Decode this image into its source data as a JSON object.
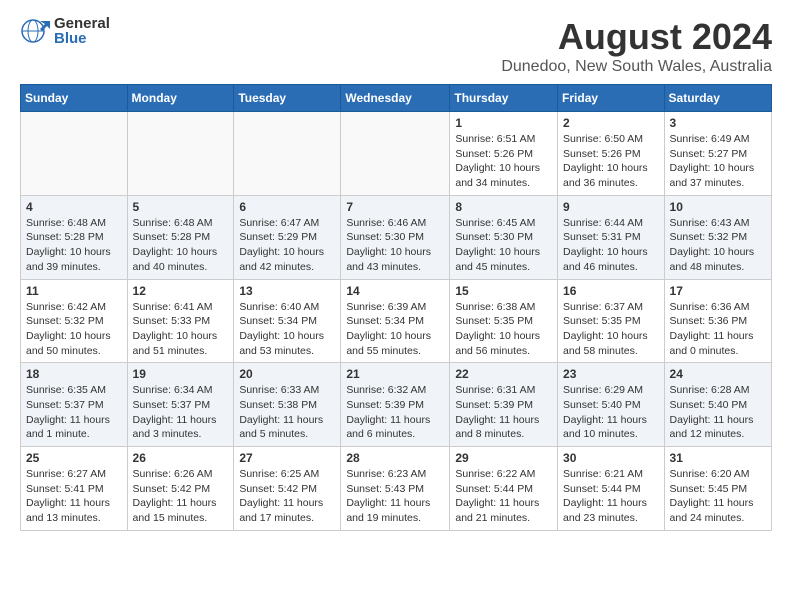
{
  "logo": {
    "general": "General",
    "blue": "Blue"
  },
  "header": {
    "title": "August 2024",
    "subtitle": "Dunedoo, New South Wales, Australia"
  },
  "weekdays": [
    "Sunday",
    "Monday",
    "Tuesday",
    "Wednesday",
    "Thursday",
    "Friday",
    "Saturday"
  ],
  "weeks": [
    [
      {
        "day": "",
        "info": ""
      },
      {
        "day": "",
        "info": ""
      },
      {
        "day": "",
        "info": ""
      },
      {
        "day": "",
        "info": ""
      },
      {
        "day": "1",
        "info": "Sunrise: 6:51 AM\nSunset: 5:26 PM\nDaylight: 10 hours and 34 minutes."
      },
      {
        "day": "2",
        "info": "Sunrise: 6:50 AM\nSunset: 5:26 PM\nDaylight: 10 hours and 36 minutes."
      },
      {
        "day": "3",
        "info": "Sunrise: 6:49 AM\nSunset: 5:27 PM\nDaylight: 10 hours and 37 minutes."
      }
    ],
    [
      {
        "day": "4",
        "info": "Sunrise: 6:48 AM\nSunset: 5:28 PM\nDaylight: 10 hours and 39 minutes."
      },
      {
        "day": "5",
        "info": "Sunrise: 6:48 AM\nSunset: 5:28 PM\nDaylight: 10 hours and 40 minutes."
      },
      {
        "day": "6",
        "info": "Sunrise: 6:47 AM\nSunset: 5:29 PM\nDaylight: 10 hours and 42 minutes."
      },
      {
        "day": "7",
        "info": "Sunrise: 6:46 AM\nSunset: 5:30 PM\nDaylight: 10 hours and 43 minutes."
      },
      {
        "day": "8",
        "info": "Sunrise: 6:45 AM\nSunset: 5:30 PM\nDaylight: 10 hours and 45 minutes."
      },
      {
        "day": "9",
        "info": "Sunrise: 6:44 AM\nSunset: 5:31 PM\nDaylight: 10 hours and 46 minutes."
      },
      {
        "day": "10",
        "info": "Sunrise: 6:43 AM\nSunset: 5:32 PM\nDaylight: 10 hours and 48 minutes."
      }
    ],
    [
      {
        "day": "11",
        "info": "Sunrise: 6:42 AM\nSunset: 5:32 PM\nDaylight: 10 hours and 50 minutes."
      },
      {
        "day": "12",
        "info": "Sunrise: 6:41 AM\nSunset: 5:33 PM\nDaylight: 10 hours and 51 minutes."
      },
      {
        "day": "13",
        "info": "Sunrise: 6:40 AM\nSunset: 5:34 PM\nDaylight: 10 hours and 53 minutes."
      },
      {
        "day": "14",
        "info": "Sunrise: 6:39 AM\nSunset: 5:34 PM\nDaylight: 10 hours and 55 minutes."
      },
      {
        "day": "15",
        "info": "Sunrise: 6:38 AM\nSunset: 5:35 PM\nDaylight: 10 hours and 56 minutes."
      },
      {
        "day": "16",
        "info": "Sunrise: 6:37 AM\nSunset: 5:35 PM\nDaylight: 10 hours and 58 minutes."
      },
      {
        "day": "17",
        "info": "Sunrise: 6:36 AM\nSunset: 5:36 PM\nDaylight: 11 hours and 0 minutes."
      }
    ],
    [
      {
        "day": "18",
        "info": "Sunrise: 6:35 AM\nSunset: 5:37 PM\nDaylight: 11 hours and 1 minute."
      },
      {
        "day": "19",
        "info": "Sunrise: 6:34 AM\nSunset: 5:37 PM\nDaylight: 11 hours and 3 minutes."
      },
      {
        "day": "20",
        "info": "Sunrise: 6:33 AM\nSunset: 5:38 PM\nDaylight: 11 hours and 5 minutes."
      },
      {
        "day": "21",
        "info": "Sunrise: 6:32 AM\nSunset: 5:39 PM\nDaylight: 11 hours and 6 minutes."
      },
      {
        "day": "22",
        "info": "Sunrise: 6:31 AM\nSunset: 5:39 PM\nDaylight: 11 hours and 8 minutes."
      },
      {
        "day": "23",
        "info": "Sunrise: 6:29 AM\nSunset: 5:40 PM\nDaylight: 11 hours and 10 minutes."
      },
      {
        "day": "24",
        "info": "Sunrise: 6:28 AM\nSunset: 5:40 PM\nDaylight: 11 hours and 12 minutes."
      }
    ],
    [
      {
        "day": "25",
        "info": "Sunrise: 6:27 AM\nSunset: 5:41 PM\nDaylight: 11 hours and 13 minutes."
      },
      {
        "day": "26",
        "info": "Sunrise: 6:26 AM\nSunset: 5:42 PM\nDaylight: 11 hours and 15 minutes."
      },
      {
        "day": "27",
        "info": "Sunrise: 6:25 AM\nSunset: 5:42 PM\nDaylight: 11 hours and 17 minutes."
      },
      {
        "day": "28",
        "info": "Sunrise: 6:23 AM\nSunset: 5:43 PM\nDaylight: 11 hours and 19 minutes."
      },
      {
        "day": "29",
        "info": "Sunrise: 6:22 AM\nSunset: 5:44 PM\nDaylight: 11 hours and 21 minutes."
      },
      {
        "day": "30",
        "info": "Sunrise: 6:21 AM\nSunset: 5:44 PM\nDaylight: 11 hours and 23 minutes."
      },
      {
        "day": "31",
        "info": "Sunrise: 6:20 AM\nSunset: 5:45 PM\nDaylight: 11 hours and 24 minutes."
      }
    ]
  ]
}
